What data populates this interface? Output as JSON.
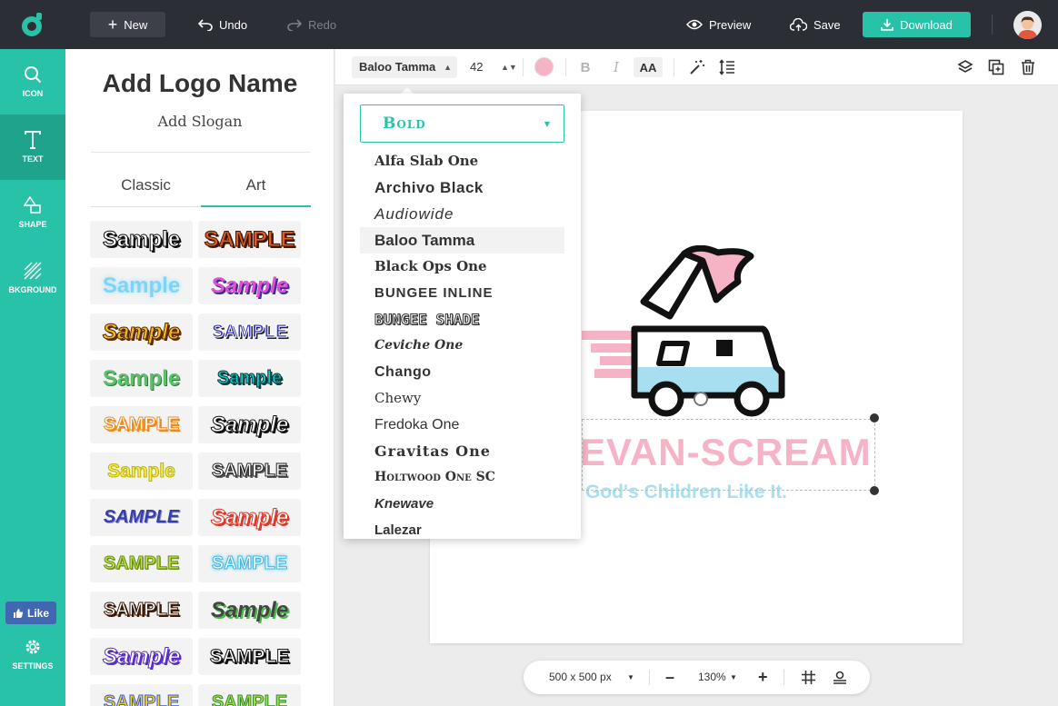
{
  "topbar": {
    "new_label": "New",
    "undo_label": "Undo",
    "redo_label": "Redo",
    "preview_label": "Preview",
    "save_label": "Save",
    "download_label": "Download"
  },
  "rail": {
    "items": [
      {
        "label": "ICON",
        "icon": "search-icon"
      },
      {
        "label": "TEXT",
        "icon": "text-icon"
      },
      {
        "label": "SHAPE",
        "icon": "shape-icon"
      },
      {
        "label": "BKGROUND",
        "icon": "background-icon"
      }
    ],
    "active": "TEXT",
    "like_label": "Like",
    "settings_label": "SETTINGS"
  },
  "panel": {
    "logo_name": "Add Logo Name",
    "slogan": "Add Slogan",
    "tabs": [
      "Classic",
      "Art"
    ],
    "active_tab": "Art",
    "samples": [
      "Sample",
      "SAMPLE",
      "Sample",
      "Sample",
      "Sample",
      "SAMPLE",
      "Sample",
      "Sample",
      "SAMPLE",
      "Sample",
      "Sample",
      "SAMPLE",
      "SAMPLE",
      "Sample",
      "SAMPLE",
      "SAMPLE",
      "SAMPLE",
      "Sample",
      "Sample",
      "SAMPLE",
      "SAMPLE",
      "SAMPLE"
    ]
  },
  "toolbar": {
    "font": "Baloo Tamma",
    "size": "42",
    "color": "#f7b3c6",
    "bold": "B",
    "italic": "I",
    "case": "AA"
  },
  "dropdown": {
    "weight": "Bold",
    "fonts": [
      "Alfa Slab One",
      "Archivo Black",
      "Audiowide",
      "Baloo Tamma",
      "Black Ops One",
      "BUNGEE INLINE",
      "BUNGEE SHADE",
      "Ceviche One",
      "Chango",
      "Chewy",
      "Fredoka One",
      "Gravitas One",
      "Holtwood One SC",
      "Knewave",
      "Lalezar"
    ],
    "selected": "Baloo Tamma"
  },
  "canvas": {
    "brand": "EVAN-SCREAM",
    "slogan": "God's Children Like It."
  },
  "bottombar": {
    "size": "500 x 500 px",
    "zoom": "130%"
  },
  "colors": {
    "accent": "#28c2a8",
    "topbar": "#2b2e35",
    "pink": "#f7b3c6",
    "light_blue": "#a8dff0"
  }
}
